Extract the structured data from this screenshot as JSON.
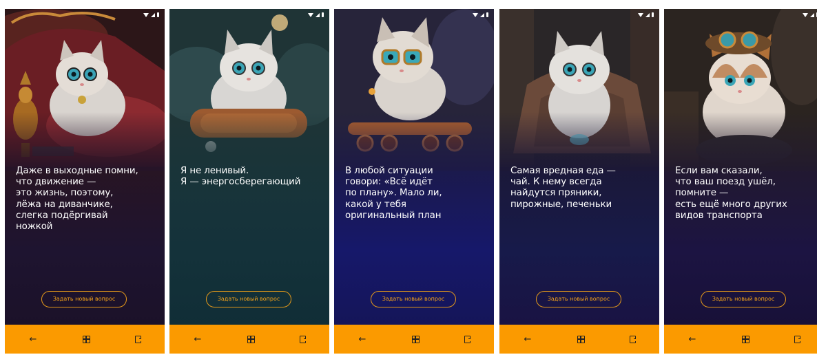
{
  "colors": {
    "accent": "#FB9A00",
    "button_outline": "#E59A1A",
    "quote_text": "#FFFFFF"
  },
  "screens": [
    {
      "illustration": "cat-with-glasses-on-sofa",
      "quote": "Даже в выходные помни,\nчто движение —\nэто жизнь, поэтому,\nлёжа на диванчике,\nслегка подёргивай\nножкой",
      "ask_button_label": "Задать новый вопрос"
    },
    {
      "illustration": "fluffy-cat-with-glasses-on-pillow",
      "quote": "Я не ленивый.\nЯ — энергосберегающий",
      "ask_button_label": "Задать новый вопрос"
    },
    {
      "illustration": "kitten-with-glasses-on-skateboard",
      "quote": "В любой ситуации\nговори: «Всё идёт\nпо плану». Мало ли,\nкакой у тебя\nоригинальный план",
      "ask_button_label": "Задать новый вопрос"
    },
    {
      "illustration": "cat-with-glasses-in-cloak",
      "quote": "Самая вредная еда —\nчай. К нему всегда\nнайдутся пряники,\nпирожные, печеньки",
      "ask_button_label": "Задать новый вопрос"
    },
    {
      "illustration": "kitten-with-goggles-steampunk",
      "quote": "Если вам сказали,\nчто ваш поезд ушёл,\nпомните —\nесть ещё много других\nвидов транспорта",
      "ask_button_label": "Задать новый вопрос"
    }
  ],
  "nav": {
    "back_icon": "←",
    "home_icon": "home-grid-icon",
    "exit_icon": "exit-icon"
  }
}
